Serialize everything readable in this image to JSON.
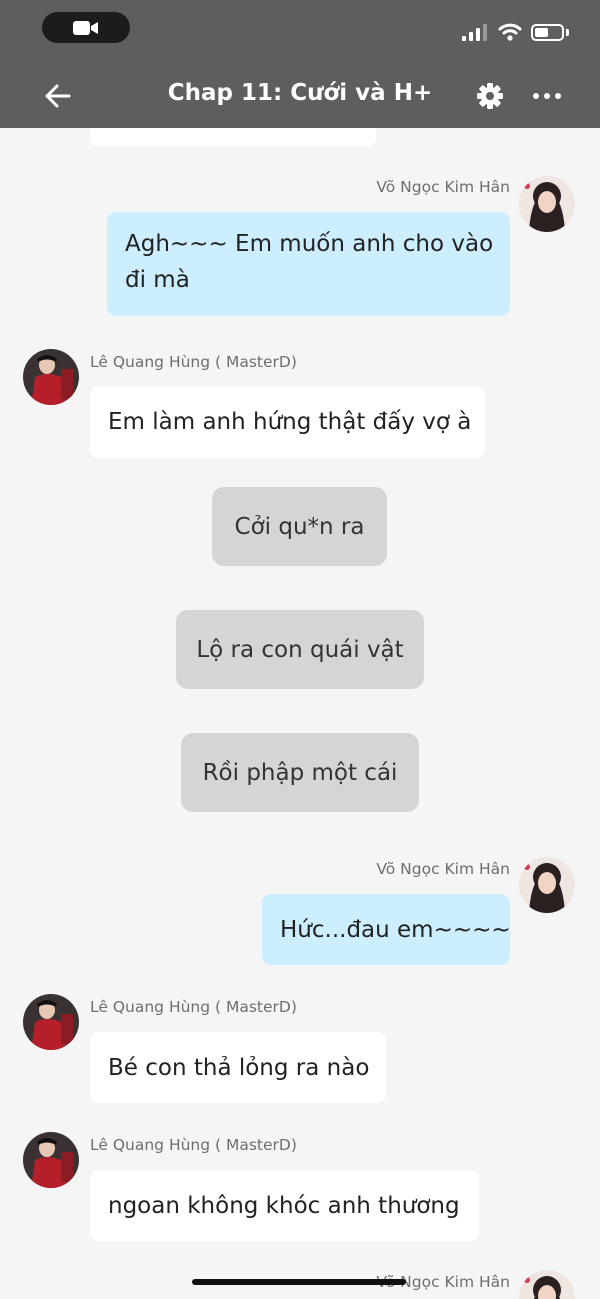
{
  "header": {
    "title": "Chap 11: Cưới và H+"
  },
  "icons": {
    "video": "video-camera-icon",
    "back": "arrow-left-icon",
    "settings": "gear-icon",
    "more": "ellipsis-icon"
  },
  "colors": {
    "header_bg": "#5e5e5e",
    "self_bubble": "#cdeefe",
    "other_bubble": "#ffffff",
    "action_bubble": "#d5d5d5"
  },
  "messages": [
    {
      "type": "message",
      "side": "right",
      "sender": "Võ Ngọc Kim Hân",
      "lines": [
        "Agh~~~ Em muốn anh cho vào",
        "đi mà"
      ]
    },
    {
      "type": "message",
      "side": "left",
      "sender": "Lê Quang Hùng ( MasterD)",
      "lines": [
        "Em làm anh hứng thật đấy vợ à"
      ]
    },
    {
      "type": "action",
      "text": "Cởi qu*n ra"
    },
    {
      "type": "action",
      "text": "Lộ ra con quái vật"
    },
    {
      "type": "action",
      "text": "Rồi phập một cái"
    },
    {
      "type": "message",
      "side": "right",
      "sender": "Võ Ngọc Kim Hân",
      "lines": [
        "Hức...đau em~~~~"
      ]
    },
    {
      "type": "message",
      "side": "left",
      "sender": "Lê Quang Hùng ( MasterD)",
      "lines": [
        "Bé con thả lỏng ra nào"
      ]
    },
    {
      "type": "message",
      "side": "left",
      "sender": "Lê Quang Hùng ( MasterD)",
      "lines": [
        "ngoan không khóc anh thương"
      ]
    },
    {
      "type": "message",
      "side": "right",
      "sender": "Võ Ngọc Kim Hân",
      "lines": []
    }
  ]
}
